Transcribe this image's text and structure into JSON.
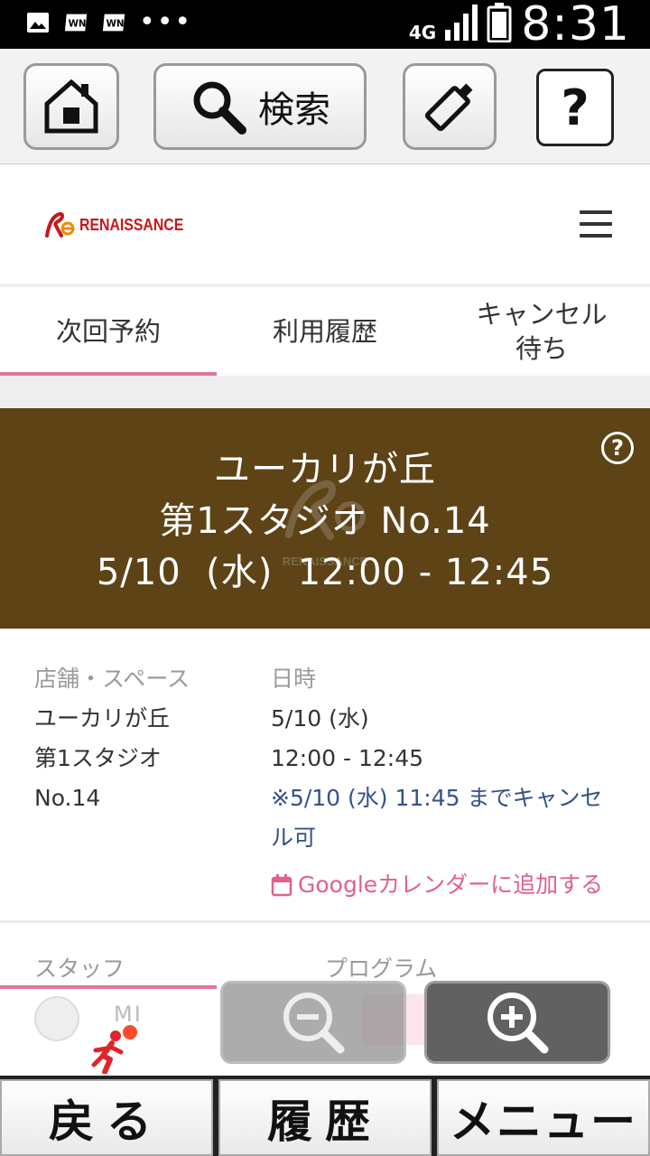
{
  "status_bar": {
    "network": "4G",
    "time": "8:31",
    "icons": [
      "image-icon",
      "sim-notification-icon",
      "sim-notification-icon",
      "more-icon",
      "signal-icon",
      "battery-icon"
    ]
  },
  "toolbar": {
    "search_label": "検索",
    "help_label": "?"
  },
  "site": {
    "logo_text": "RENAISSANCE"
  },
  "tabs": [
    {
      "label": "次回予約"
    },
    {
      "label": "利用履歴"
    },
    {
      "label": "キャンセル\n待ち"
    }
  ],
  "banner": {
    "line1": "ユーカリが丘",
    "line2": "第1スタジオ No.14",
    "line3": "5/10  (水)  12:00 - 12:45",
    "watermark_text": "RENAISSANCE",
    "help": "?"
  },
  "details": {
    "left_head": "店舗・スペース",
    "left_line1": "ユーカリが丘",
    "left_line2": "第1スタジオ",
    "left_line3": "No.14",
    "right_head": "日時",
    "right_date": "5/10 (水)",
    "right_time": "12:00 - 12:45",
    "cancel_note": "※5/10 (水) 11:45 までキャンセル可",
    "gcal_link": "Googleカレンダーに追加する"
  },
  "staff": {
    "staff_head": "スタッフ",
    "program_head": "プログラム",
    "staff_name": "MI"
  },
  "bottom_nav": {
    "back": "戻る",
    "history": "履歴",
    "menu": "メニュー"
  },
  "colors": {
    "banner_bg": "#5e4316",
    "accent_pink": "#e0749b",
    "note_blue": "#36518a",
    "brand_red": "#c8161d"
  }
}
